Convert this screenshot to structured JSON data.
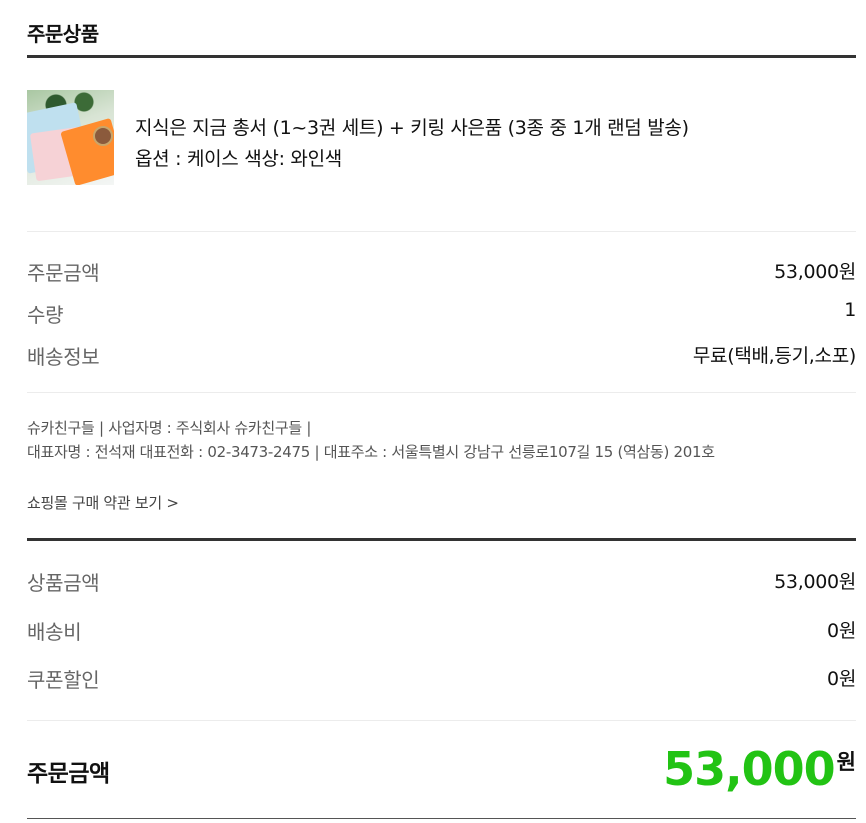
{
  "section_title": "주문상품",
  "product": {
    "name": "지식은 지금 총서 (1~3권 세트) + 키링 사은품 (3종 중 1개 랜덤 발송)",
    "option": "옵션 : 케이스 색상: 와인색",
    "thumbnail": "product-thumbnail-image"
  },
  "order_rows": [
    {
      "label": "주문금액",
      "value": "53,000원"
    },
    {
      "label": "수량",
      "value": "1"
    },
    {
      "label": "배송정보",
      "value": "무료(택배,등기,소포)"
    }
  ],
  "company": {
    "line1": "슈카친구들 | 사업자명 : 주식회사 슈카친구들 |",
    "line2": "대표자명 : 전석재 대표전화 : 02-3473-2475 | 대표주소 : 서울특별시 강남구 선릉로107길 15 (역삼동) 201호"
  },
  "terms_link": "쇼핑몰 구매 약관 보기 >",
  "summary_rows": [
    {
      "label": "상품금액",
      "value": "53,000원"
    },
    {
      "label": "배송비",
      "value": "0원"
    },
    {
      "label": "쿠폰할인",
      "value": "0원"
    }
  ],
  "total": {
    "label": "주문금액",
    "amount": "53,000",
    "unit": "원"
  },
  "colors": {
    "accent_green": "#22c314",
    "rule_dark": "#333333"
  }
}
